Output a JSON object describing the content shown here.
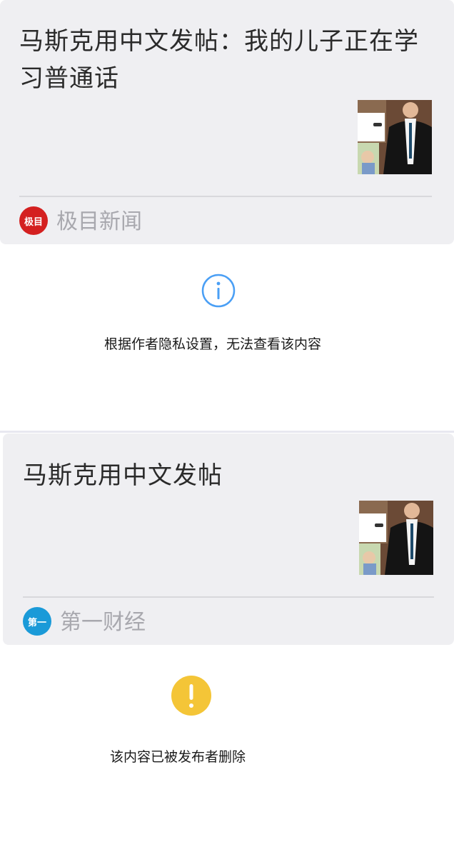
{
  "posts": [
    {
      "title": "马斯克用中文发帖：我的儿子正在学习普通话",
      "source": "极目新闻",
      "logo_text": "极目",
      "logo_color": "#d42020"
    },
    {
      "title": "马斯克用中文发帖",
      "source": "第一财经",
      "logo_text": "第一",
      "logo_color": "#1a9ad8"
    }
  ],
  "notices": [
    {
      "icon": "info-icon",
      "color": "#4a9ff5",
      "text": "根据作者隐私设置，无法查看该内容"
    },
    {
      "icon": "warning-icon",
      "color": "#f4c537",
      "text": "该内容已被发布者删除"
    }
  ]
}
